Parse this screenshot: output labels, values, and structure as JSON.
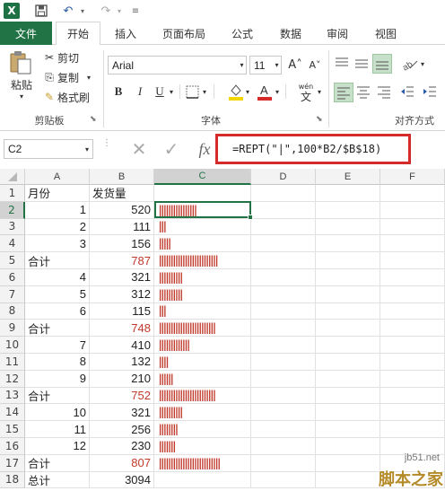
{
  "titlebar": {
    "app_logo": "X",
    "undo_glyph": "↶",
    "redo_glyph": "↷",
    "save_icon": "save-icon"
  },
  "tabs": [
    "文件",
    "开始",
    "插入",
    "页面布局",
    "公式",
    "数据",
    "审阅",
    "视图"
  ],
  "ribbon": {
    "paste_label": "粘贴",
    "cut_label": "剪切",
    "copy_label": "复制",
    "format_painter_label": "格式刷",
    "clipboard_group": "剪贴板",
    "font_name": "Arial",
    "font_size": "11",
    "grow_font": "A˄",
    "shrink_font": "A˅",
    "bold": "B",
    "italic": "I",
    "underline": "U",
    "phonetic_label": "wén",
    "font_group": "字体",
    "align_group": "对齐方式"
  },
  "formula_bar": {
    "name_box": "C2",
    "fx": "fx",
    "formula": "=REPT(\"|\",100*B2/$B$18)"
  },
  "columns": [
    "A",
    "B",
    "C",
    "D",
    "E",
    "F"
  ],
  "rows": [
    {
      "n": "1",
      "a": "月份",
      "a_type": "text",
      "b": "发货量",
      "b_type": "text",
      "bars": 0,
      "red": false
    },
    {
      "n": "2",
      "a": "1",
      "a_type": "num",
      "b": "520",
      "b_type": "num",
      "bars": 16,
      "red": false
    },
    {
      "n": "3",
      "a": "2",
      "a_type": "num",
      "b": "111",
      "b_type": "num",
      "bars": 3,
      "red": false
    },
    {
      "n": "4",
      "a": "3",
      "a_type": "num",
      "b": "156",
      "b_type": "num",
      "bars": 5,
      "red": false
    },
    {
      "n": "5",
      "a": "合计",
      "a_type": "text",
      "b": "787",
      "b_type": "num",
      "bars": 25,
      "red": true
    },
    {
      "n": "6",
      "a": "4",
      "a_type": "num",
      "b": "321",
      "b_type": "num",
      "bars": 10,
      "red": false
    },
    {
      "n": "7",
      "a": "5",
      "a_type": "num",
      "b": "312",
      "b_type": "num",
      "bars": 10,
      "red": false
    },
    {
      "n": "8",
      "a": "6",
      "a_type": "num",
      "b": "115",
      "b_type": "num",
      "bars": 3,
      "red": false
    },
    {
      "n": "9",
      "a": "合计",
      "a_type": "text",
      "b": "748",
      "b_type": "num",
      "bars": 24,
      "red": true
    },
    {
      "n": "10",
      "a": "7",
      "a_type": "num",
      "b": "410",
      "b_type": "num",
      "bars": 13,
      "red": false
    },
    {
      "n": "11",
      "a": "8",
      "a_type": "num",
      "b": "132",
      "b_type": "num",
      "bars": 4,
      "red": false
    },
    {
      "n": "12",
      "a": "9",
      "a_type": "num",
      "b": "210",
      "b_type": "num",
      "bars": 6,
      "red": false
    },
    {
      "n": "13",
      "a": "合计",
      "a_type": "text",
      "b": "752",
      "b_type": "num",
      "bars": 24,
      "red": true
    },
    {
      "n": "14",
      "a": "10",
      "a_type": "num",
      "b": "321",
      "b_type": "num",
      "bars": 10,
      "red": false
    },
    {
      "n": "15",
      "a": "11",
      "a_type": "num",
      "b": "256",
      "b_type": "num",
      "bars": 8,
      "red": false
    },
    {
      "n": "16",
      "a": "12",
      "a_type": "num",
      "b": "230",
      "b_type": "num",
      "bars": 7,
      "red": false
    },
    {
      "n": "17",
      "a": "合计",
      "a_type": "text",
      "b": "807",
      "b_type": "num",
      "bars": 26,
      "red": true
    },
    {
      "n": "18",
      "a": "总计",
      "a_type": "text",
      "b": "3094",
      "b_type": "num",
      "bars": 0,
      "red": false
    }
  ],
  "watermark": {
    "url": "jb51.net",
    "name": "脚本之家"
  },
  "colors": {
    "excel_green": "#217346",
    "highlight_red": "#d42a2a",
    "value_red": "#c0392b",
    "selection": "#217346"
  }
}
